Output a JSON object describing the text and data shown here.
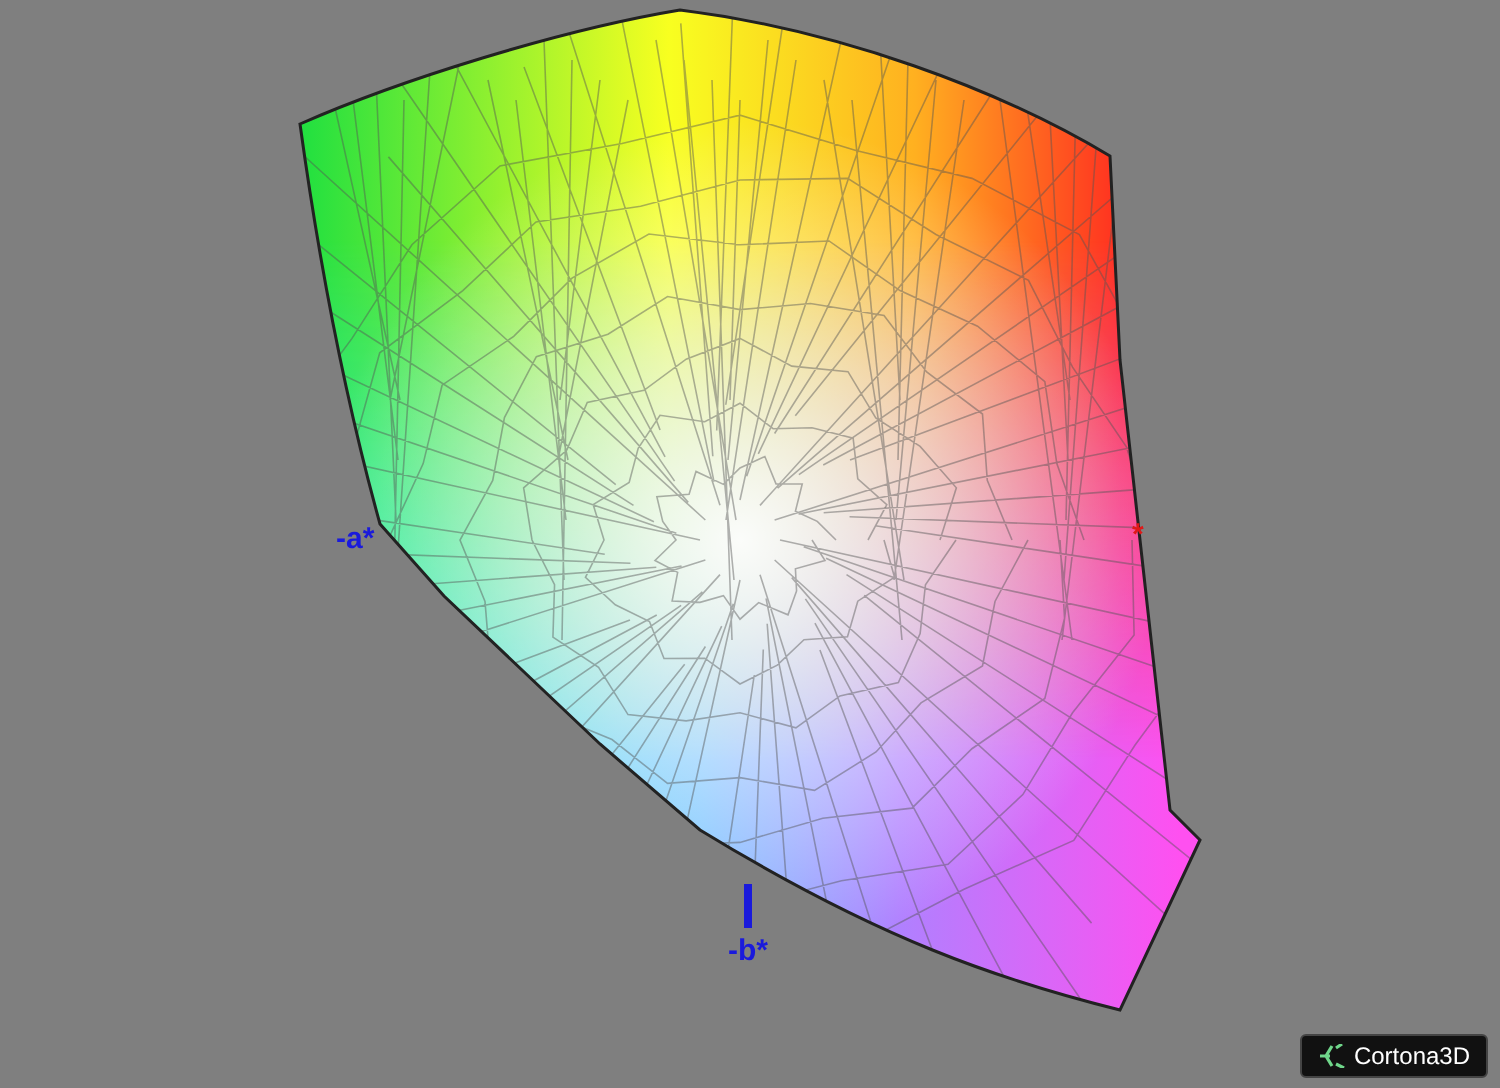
{
  "viewer": {
    "axis_labels": [
      {
        "text": "-a*",
        "color": "#1a1adc"
      },
      {
        "text": "*",
        "color": "#e01818"
      },
      {
        "text": "-b*",
        "color": "#1a1adc"
      }
    ],
    "logo": {
      "text": "Cortona3D"
    }
  }
}
